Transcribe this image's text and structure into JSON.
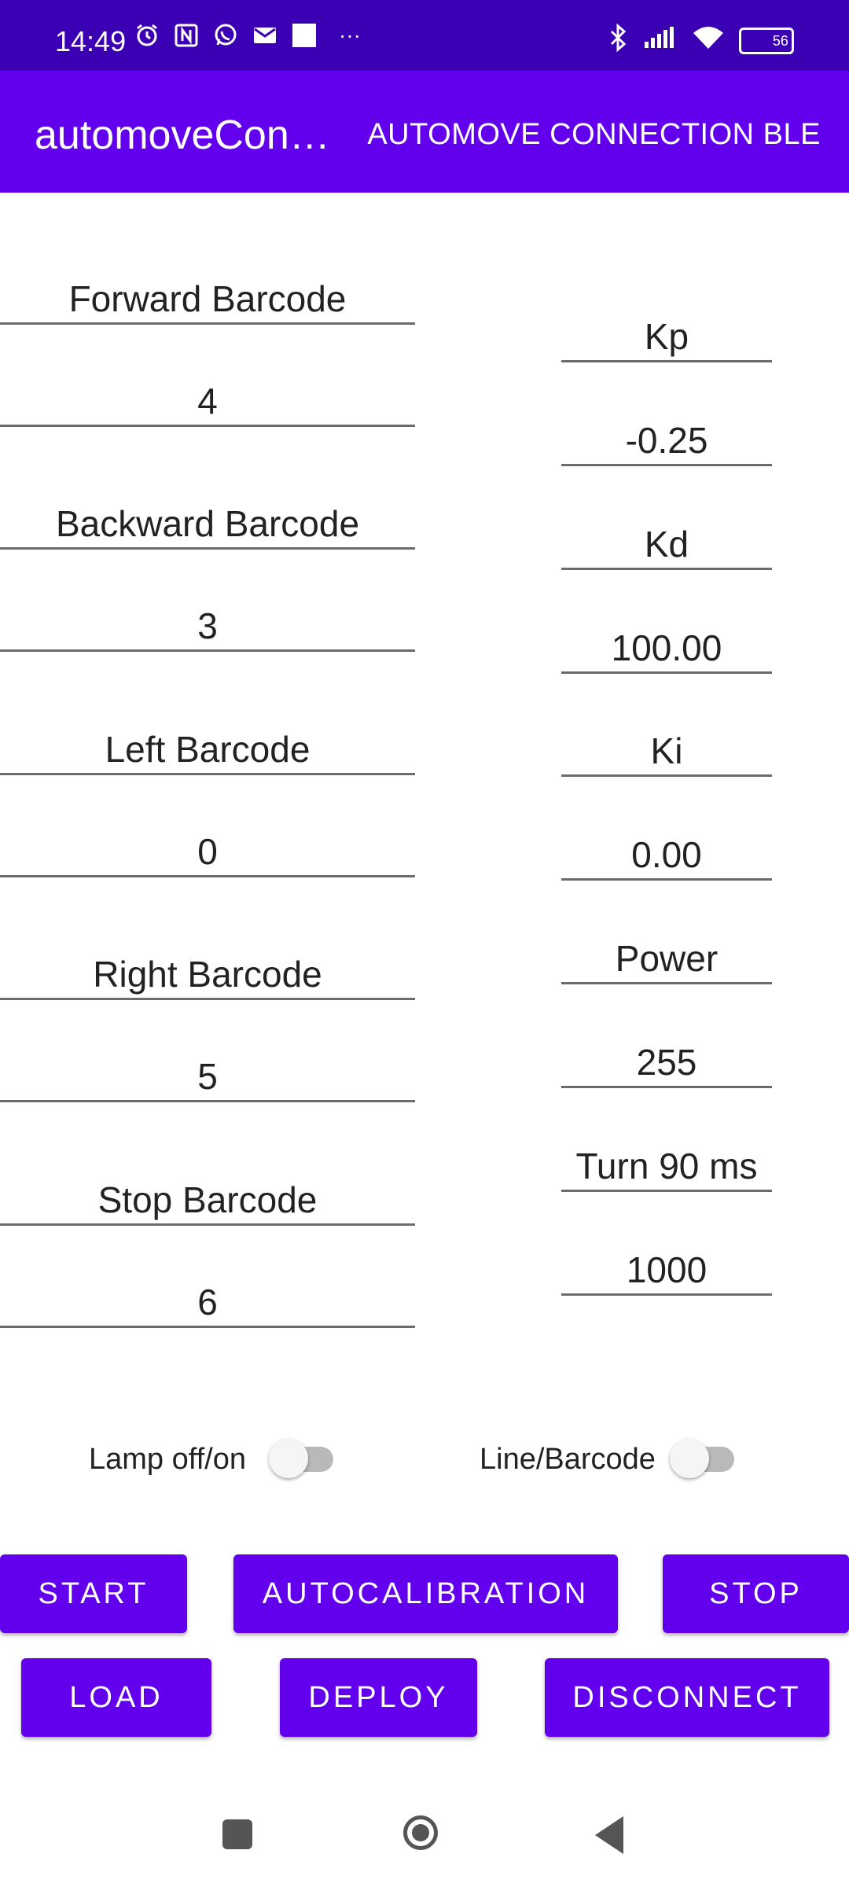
{
  "status_bar": {
    "time": "14:49",
    "battery_level": "56",
    "icons_left": [
      "alarm-icon",
      "nfc-icon",
      "whatsapp-icon",
      "mail-icon",
      "square-icon",
      "more-icon"
    ],
    "icons_right": [
      "bluetooth-icon",
      "signal-icon",
      "wifi-icon",
      "battery-icon"
    ],
    "more": "···"
  },
  "app_bar": {
    "title": "automoveCon…",
    "action": "AUTOMOVE CONNECTION BLE"
  },
  "left_fields": [
    {
      "label": "Forward Barcode",
      "value": "4"
    },
    {
      "label": "Backward Barcode",
      "value": "3"
    },
    {
      "label": "Left Barcode",
      "value": "0"
    },
    {
      "label": "Right Barcode",
      "value": "5"
    },
    {
      "label": "Stop Barcode",
      "value": "6"
    }
  ],
  "right_fields": [
    {
      "label": "Kp",
      "value": "-0.25"
    },
    {
      "label": "Kd",
      "value": "100.00"
    },
    {
      "label": "Ki",
      "value": "0.00"
    },
    {
      "label": "Power",
      "value": "255"
    },
    {
      "label": "Turn 90 ms",
      "value": "1000"
    }
  ],
  "switches": {
    "lamp_label": "Lamp off/on",
    "lamp_on": false,
    "line_label": "Line/Barcode",
    "line_on": false
  },
  "buttons": {
    "start": "START",
    "autocalibration": "AUTOCALIBRATION",
    "stop": "STOP",
    "load": "LOAD",
    "deploy": "DEPLOY",
    "disconnect": "DISCONNECT"
  },
  "colors": {
    "status_bar": "#3c00b4",
    "app_bar": "#6200ee",
    "button": "#6200ee"
  }
}
